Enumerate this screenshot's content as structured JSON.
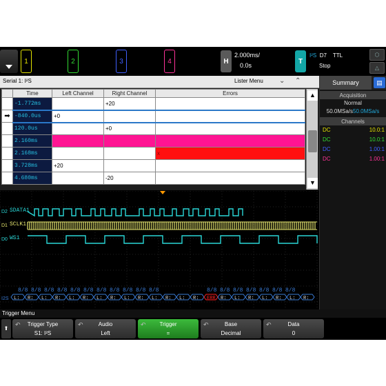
{
  "topbar": {
    "channels": [
      {
        "label": "1",
        "color": "#e6e600"
      },
      {
        "label": "2",
        "color": "#33dd33"
      },
      {
        "label": "3",
        "color": "#4060ff"
      },
      {
        "label": "4",
        "color": "#ff3399"
      }
    ],
    "horizontal": {
      "key": "H",
      "scale": "2.000ms/",
      "delay": "0.0s"
    },
    "trigger": {
      "key": "T",
      "source_prefix": "I²S",
      "source": "D7",
      "level": "TTL",
      "mode": "Stop"
    }
  },
  "lister": {
    "title": "Serial 1: I²S",
    "menu_label": "Lister Menu",
    "columns": [
      "Time",
      "Left Channel",
      "Right Channel",
      "Errors"
    ],
    "rows": [
      {
        "time": "-1.772ms",
        "left": "",
        "right": "+20",
        "errors": "",
        "color": ""
      },
      {
        "time": "-840.0us",
        "left": "+0",
        "right": "",
        "errors": "",
        "color": "",
        "selected": true
      },
      {
        "time": "120.0us",
        "left": "",
        "right": "+0",
        "errors": "",
        "color": ""
      },
      {
        "time": "2.160ms",
        "left": "",
        "right": "",
        "errors": "",
        "color": "#ff1493"
      },
      {
        "time": "2.168ms",
        "left": "",
        "right": "",
        "errors": "x",
        "color": "#ff0000"
      },
      {
        "time": "3.728ms",
        "left": "+20",
        "right": "",
        "errors": "",
        "color": ""
      },
      {
        "time": "4.680ms",
        "left": "",
        "right": "-20",
        "errors": "",
        "color": ""
      }
    ]
  },
  "waveform": {
    "channels": [
      {
        "id": "D2",
        "name": "SDATA1",
        "color": "#2ad8d8"
      },
      {
        "id": "D1",
        "name": "SCLK1",
        "color": "#e6e66e"
      },
      {
        "id": "D0",
        "name": "WS1",
        "color": "#2ad8d8"
      }
    ],
    "bus_label": "I2S",
    "word_size_label": "8/8",
    "decode_labels": [
      "L:",
      "R:",
      "L:",
      "R:",
      "L:",
      "R:",
      "L:",
      "R:",
      "L:",
      "R:",
      "L:",
      "R:",
      "L:",
      "R:",
      "ERR",
      "R:",
      "L:",
      "R:",
      "L:",
      "R:",
      "L:",
      "R:"
    ],
    "error_label": "ERR"
  },
  "side_panel": {
    "tab": "Summary",
    "acquisition_title": "Acquisition",
    "mode": "Normal",
    "rate_left": "50.0MSa/s",
    "rate_right": "50.0MSa/s",
    "channels_title": "Channels",
    "channels": [
      {
        "coupling": "DC",
        "probe": "10.0:1",
        "color": "#e6e600"
      },
      {
        "coupling": "DC",
        "probe": "10.0:1",
        "color": "#33dd33"
      },
      {
        "coupling": "DC",
        "probe": "1.00:1",
        "color": "#4060ff"
      },
      {
        "coupling": "DC",
        "probe": "1.00:1",
        "color": "#ff3399"
      }
    ]
  },
  "softkeys": {
    "menu_title": "Trigger Menu",
    "back_label": "⬆",
    "keys": [
      {
        "title": "Trigger Type",
        "value": "S1: I²S"
      },
      {
        "title": "Audio",
        "value": "Left"
      },
      {
        "title": "Trigger",
        "value": "="
      },
      {
        "title": "Base",
        "value": "Decimal"
      },
      {
        "title": "Data",
        "value": "0"
      }
    ]
  }
}
